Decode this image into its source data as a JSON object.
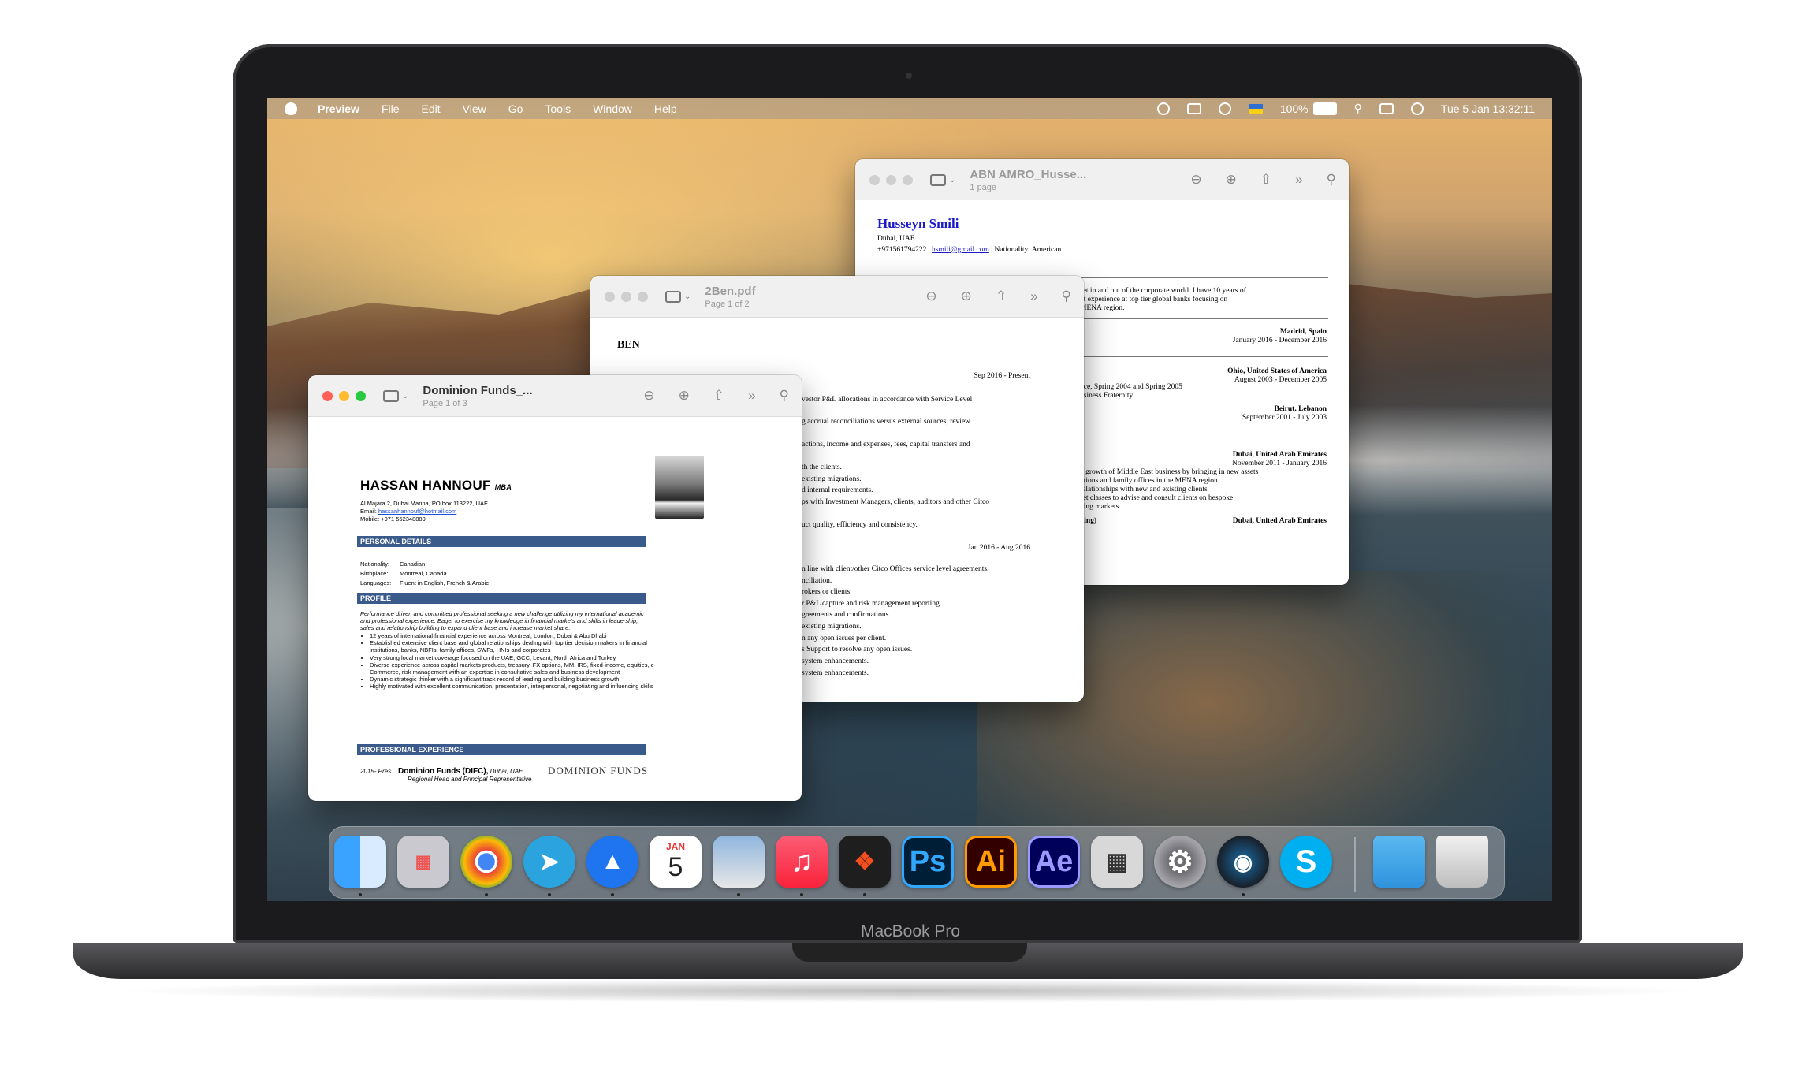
{
  "menubar": {
    "app": "Preview",
    "items": [
      "File",
      "Edit",
      "View",
      "Go",
      "Tools",
      "Window",
      "Help"
    ],
    "battery": "100%",
    "clock": "Tue 5 Jan  13:32:11"
  },
  "windows": {
    "back": {
      "title": "ABN AMRO_Husse...",
      "subtitle": "1 page"
    },
    "middle": {
      "title": "2Ben.pdf",
      "subtitle": "Page 1 of 2"
    },
    "front": {
      "title": "Dominion Funds_...",
      "subtitle": "Page 1 of 3"
    }
  },
  "front_doc": {
    "name": "HASSAN HANNOUF",
    "degree": "MBA",
    "address": "Al Majara 2, Dubai Marina, PO box 113222, UAE",
    "email_label": "Email:",
    "email": "hassanhannouf@hotmail.com",
    "mobile": "Mobile: +971 552348889",
    "personal_header": "PERSONAL DETAILS",
    "personal": [
      {
        "k": "Nationality:",
        "v": "Canadian"
      },
      {
        "k": "Birthplace:",
        "v": "Montreal, Canada"
      },
      {
        "k": "Languages:",
        "v": "Fluent in English, French & Arabic"
      }
    ],
    "profile_header": "PROFILE",
    "profile_text": "Performance driven and committed professional seeking a new challenge utilizing my international academic and professional experience. Eager to exercise my knowledge in financial markets and skills in leadership, sales and relationship building to expand client base and increase market share.",
    "bullets": [
      "12 years of international financial experience across Montreal, London, Dubai & Abu Dhabi",
      "Established extensive client base and global relationships dealing with top tier decision makers in financial institutions, banks, NBFIs, family offices, SWFs, HNIs and corporates",
      "Very strong local market coverage focused on the UAE, GCC, Levant, North Africa and Turkey",
      "Diverse experience across capital markets products, treasury, FX options, MM, IRS, fixed-income, equities, e-Commerce, risk management with an expertise in consultative sales and business development",
      "Dynamic strategic thinker with a significant track record of leading and building business growth",
      "Highly motivated with excellent communication, presentation, interpersonal, negotiating and influencing skills"
    ],
    "experience_header": "PROFESSIONAL EXPERIENCE",
    "exp_years": "2015- Pres.",
    "exp_company": "Dominion Funds (DIFC),",
    "exp_location": "Dubai, UAE",
    "exp_role": "Regional Head and Principal Representative",
    "logo": "DOMINION FUNDS"
  },
  "middle_doc": {
    "heading": "BEN",
    "lines": [
      "Sep 2016 - Present",
      "vestor P&L allocations in accordance with Service Level",
      "g accrual reconciliations versus external sources, review",
      "actions, income and expenses, fees, capital transfers and",
      "th the clients.",
      "existing migrations.",
      "d internal requirements.",
      "ps with Investment Managers, clients, auditors and other Citco",
      "uct quality, efficiency and consistency.",
      "Jan 2016 - Aug 2016",
      "n line with client/other Citco Offices service level agreements.",
      "nciliation.",
      "rokers or clients.",
      "r P&L capture and risk management reporting.",
      "greements and confirmations.",
      "existing migrations.",
      "n any open issues per client.",
      "s Support to resolve any open issues.",
      "system enhancements.",
      "system enhancements."
    ]
  },
  "back_doc": {
    "name": "Husseyn Smili",
    "city": "Dubai, UAE",
    "phone": "+971561794222 |",
    "email": "hsmili@gmail.com",
    "nationality": "| Nationality: American",
    "summary": [
      "set in and out of the corporate world. I have 10 years of",
      "nt experience at top tier global banks focusing on",
      "MENA region."
    ],
    "entries": [
      {
        "place": "Madrid, Spain",
        "dates": "January 2016 - December 2016"
      },
      {
        "place": "Ohio, United States of America",
        "dates": "August 2003 - December 2005"
      },
      {
        "place": "Beirut, Lebanon",
        "dates": "September 2001 - July 2003"
      },
      {
        "place": "Dubai, United Arab Emirates",
        "dates": "November 2011 - January 2016"
      }
    ],
    "lines_ohio": [
      "nce, Spring 2004 and Spring 2005",
      "usiness Fraternity"
    ],
    "lines_dubai": [
      "d growth of Middle East business by bringing in new assets",
      "utions and family offices in the MENA region",
      "relationships with new and existing clients",
      "set classes to advise and consult clients on bespoke",
      "ging markets"
    ],
    "tail": "king)",
    "tail_place": "Dubai, United Arab Emirates"
  },
  "dock": {
    "items": [
      "Finder",
      "Launchpad",
      "Chrome",
      "Telegram",
      "Spark",
      "Calendar",
      "Preview",
      "Music",
      "Figma",
      "Photoshop",
      "Illustrator",
      "After Effects",
      "Calculator",
      "System Preferences",
      "Steam",
      "Skype",
      "Folder",
      "Trash"
    ],
    "calendar_month": "JAN",
    "calendar_day": "5",
    "ps": "Ps",
    "ai": "Ai",
    "ae": "Ae"
  },
  "device": {
    "brand": "MacBook Pro"
  }
}
